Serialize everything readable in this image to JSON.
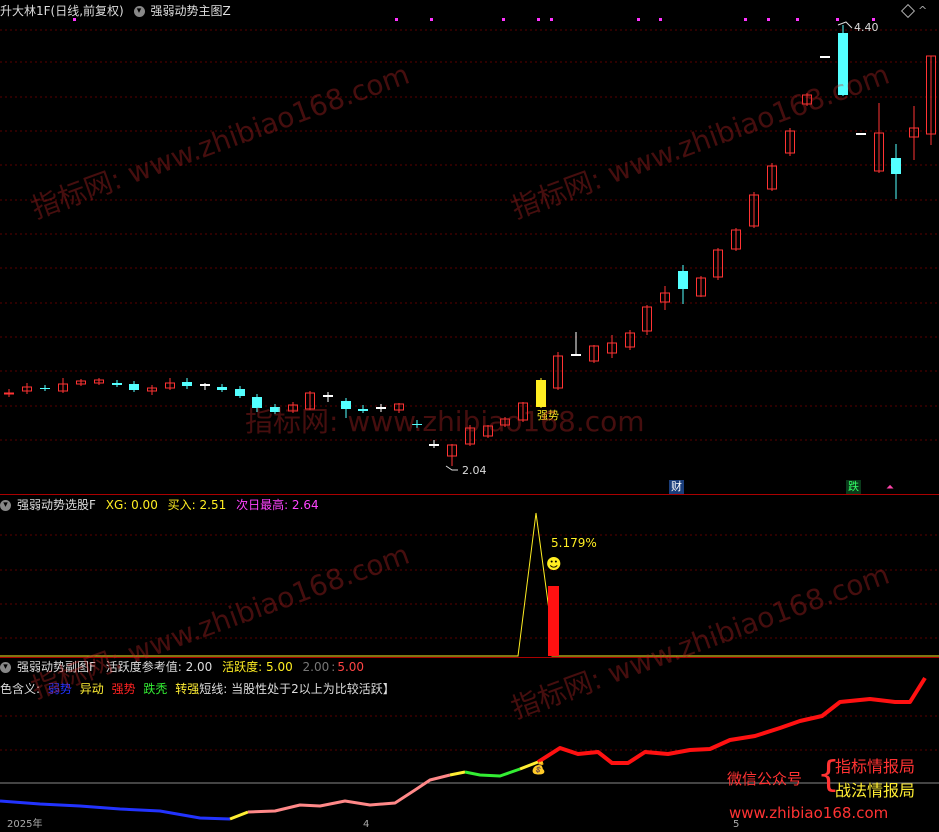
{
  "main": {
    "title": "升大林1F(日线,前复权)",
    "subtitle": "强弱动势主图Z",
    "hi_label": "4.40",
    "lo_label": "2.04",
    "signal_label": "强势",
    "bottom_tags": [
      "财",
      "跌"
    ]
  },
  "pane2": {
    "name": "强弱动势选股F",
    "xg_label": "XG: 0.00",
    "buy_label": "买入: 2.51",
    "next_label": "次日最高: 2.64",
    "pct_label": "5.179%"
  },
  "pane3": {
    "name": "强弱动势副图F",
    "ref_label": "活跃度参考值: 2.00",
    "act_label": "活跃度: 5.00",
    "v1": "2.00",
    "v2": "5.00",
    "legend_prefix": "色含义:",
    "legend_items": [
      {
        "text": "弱势",
        "color": "#2233ff"
      },
      {
        "text": "异动",
        "color": "#ffee33"
      },
      {
        "text": "强势",
        "color": "#ff2222"
      },
      {
        "text": "跌秃",
        "color": "#33ee33"
      },
      {
        "text": "转强",
        "color": "#ffee33"
      }
    ],
    "legend_note": "短线: 当股性处于2以上为比较活跃】",
    "axis_labels": [
      "2025年",
      "4",
      "5"
    ],
    "brand_line1": "指标情报局",
    "brand_line2": "战法情报局",
    "brand_prefix": "微信公众号",
    "site": "www.zhibiao168.com"
  },
  "watermark": {
    "text1": "指标网: www.zhibiao168.com",
    "text2": "www.zhibiao168.com"
  },
  "colors": {
    "up": "#ff3333",
    "down": "#54ffff",
    "flat": "#ffffff",
    "signal": "#ffee22",
    "sep": "#aa0000"
  }
}
